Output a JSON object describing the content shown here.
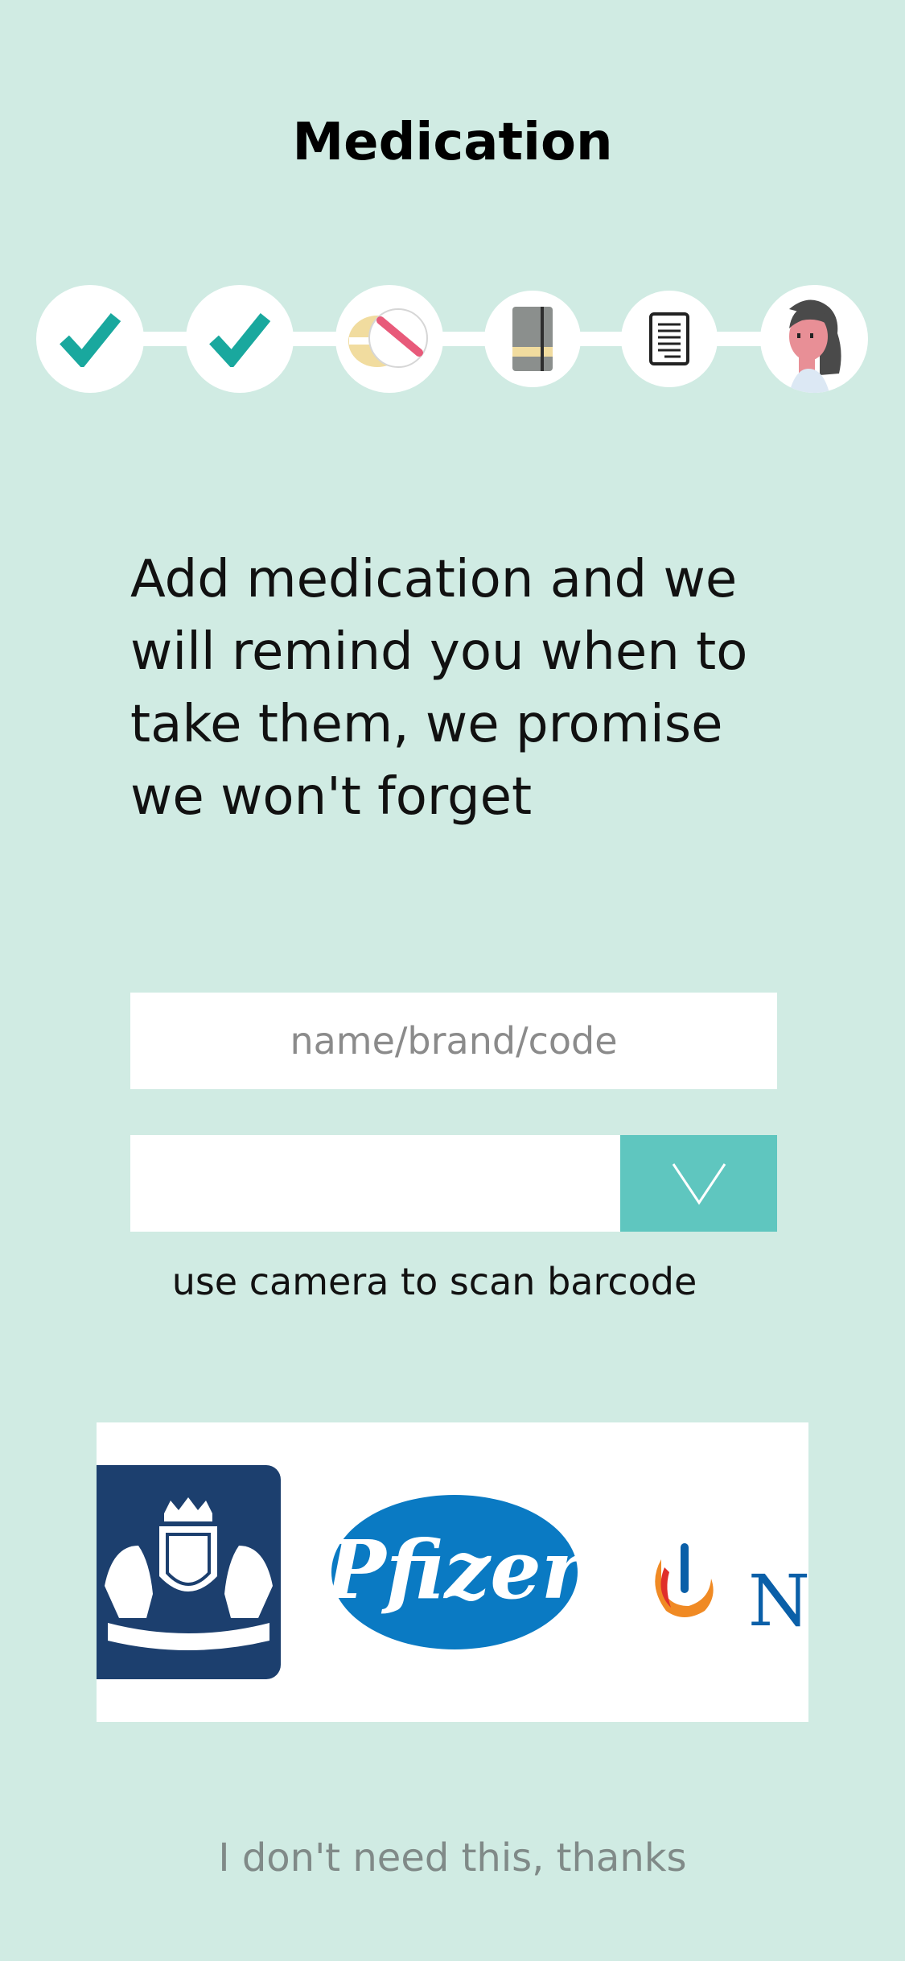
{
  "header": {
    "title": "Medication"
  },
  "stepper": {
    "steps": [
      {
        "icon": "check-icon",
        "state": "done"
      },
      {
        "icon": "check-icon",
        "state": "done"
      },
      {
        "icon": "pill-icon",
        "state": "current"
      },
      {
        "icon": "notebook-icon",
        "state": "todo"
      },
      {
        "icon": "document-icon",
        "state": "todo"
      },
      {
        "icon": "doctor-avatar-icon",
        "state": "todo"
      }
    ],
    "colors": {
      "check": "#19a89e",
      "pill_stripe": "#e85a7a",
      "notebook": "#8b8f8d",
      "band": "#f1dc9f"
    }
  },
  "intro": {
    "text": "Add medication and we will remind you when to take them, we promise we won't forget"
  },
  "search": {
    "placeholder": "name/brand/code",
    "value": ""
  },
  "dropdown": {
    "selected": "",
    "icon": "chevron-down-icon",
    "accent": "#5fc6bf"
  },
  "scan": {
    "label": "use camera to scan barcode"
  },
  "partners": {
    "logos": [
      {
        "icon": "rijksoverheid-logo",
        "alt": "coat of arms"
      },
      {
        "icon": "pfizer-logo",
        "text": "Pfizer"
      },
      {
        "icon": "novo-nordisk-logo",
        "text": "Nc"
      }
    ],
    "colors": {
      "rijk": "#1c3f6e",
      "pfizer": "#0a7ac3",
      "novo": "#0a5fa8"
    }
  },
  "footer": {
    "skip_label": "I don't need this, thanks"
  },
  "theme": {
    "background": "#d0ebe3"
  }
}
